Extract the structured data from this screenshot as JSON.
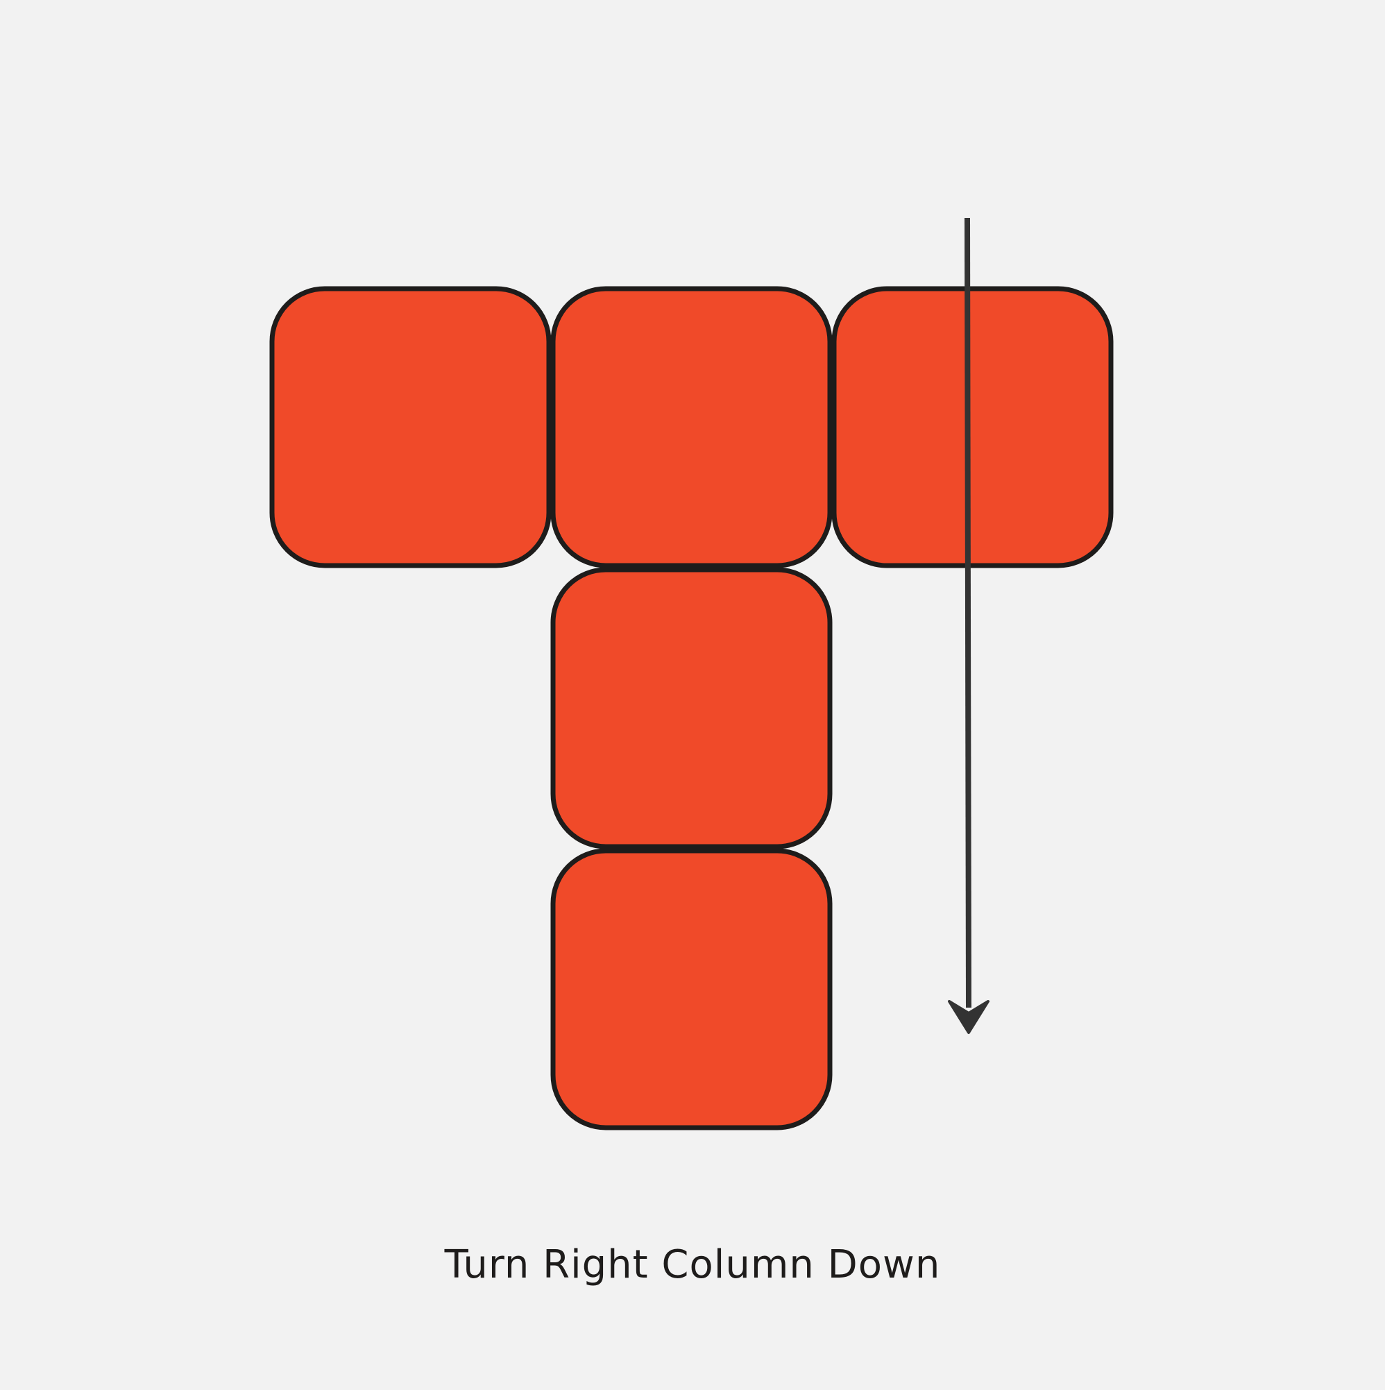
{
  "colors": {
    "background": "#f2f2f2",
    "tile_fill": "#f04a29",
    "tile_stroke": "#1e1c1b",
    "arrow": "#333333"
  },
  "diagram": {
    "shape": "T",
    "tiles": [
      {
        "name": "tile-top-left",
        "row": 0,
        "col": 0
      },
      {
        "name": "tile-top-center",
        "row": 0,
        "col": 1
      },
      {
        "name": "tile-top-right",
        "row": 0,
        "col": 2
      },
      {
        "name": "tile-middle-center",
        "row": 1,
        "col": 1
      },
      {
        "name": "tile-bottom-center",
        "row": 2,
        "col": 1
      }
    ],
    "arrow": {
      "icon": "arrow-down-icon",
      "column": 2,
      "direction": "down"
    }
  },
  "caption": "Turn Right Column Down"
}
